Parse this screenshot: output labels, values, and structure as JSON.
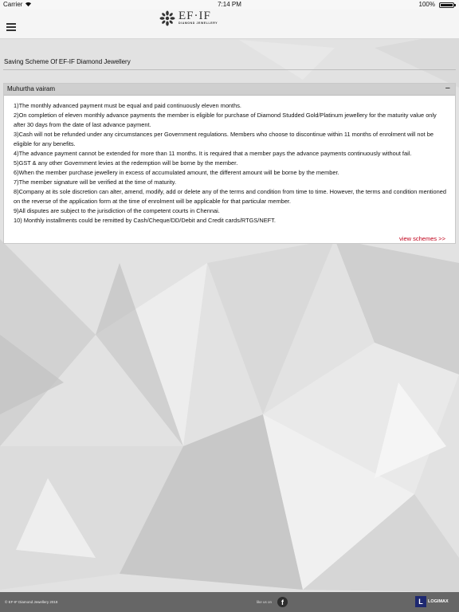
{
  "status_bar": {
    "carrier": "Carrier",
    "time": "7:14 PM",
    "battery": "100%"
  },
  "header": {
    "logo_text": "EF·IF",
    "logo_subtitle": "DIAMOND JEWELLERY",
    "menu_icon": "hamburger-icon"
  },
  "page": {
    "title": "Saving Scheme Of EF-IF Diamond Jewellery"
  },
  "panel": {
    "heading": "Muhurtha vairam",
    "collapse_symbol": "−",
    "terms": [
      "1)The monthly advanced payment must be equal and paid continuously eleven months.",
      "2)On completion of eleven monthly advance payments the member is eligible for purchase of Diamond Studded Gold/Platinum jewellery for the maturity value only after 30 days from the date of last advance payment.",
      "3)Cash will not be refunded under any circumstances per Government regulations. Members who choose to discontinue within 11 months of enrolment will not be eligible for any benefits.",
      "4)The advance payment cannot be extended for more than 11 months. It is required that a member pays the advance payments continuously without fail.",
      "5)GST & any other Government levies at the redemption will be borne by the member.",
      "6)When the member purchase jewellery in excess of accumulated amount, the different amount will be borne by the member.",
      "7)The member signature will be verified at the time of maturity.",
      "8)Company at its sole discretion can alter, amend, modify, add or delete any of the terms and condition from time to time. However, the terms and condition mentioned on the reverse of the application form at the time of enrolment will be applicable for that particular member.",
      "9)All disputes are subject to the jurisdiction of the competent courts in Chennai.",
      "10) Monthly installments could be remitted by Cash/Cheque/DD/Debit and Credit cards/RTGS/NEFT."
    ],
    "view_link": "view schemes >>"
  },
  "footer": {
    "copyright": "© EF-IF Diamond Jewellery 2018",
    "like_us": "like us on",
    "facebook_glyph": "f",
    "brand_mark": "L",
    "brand_name": "LOGIMAX"
  },
  "colors": {
    "link": "#c0001a",
    "panel_header": "#cfcfcf",
    "footer": "#666666"
  }
}
